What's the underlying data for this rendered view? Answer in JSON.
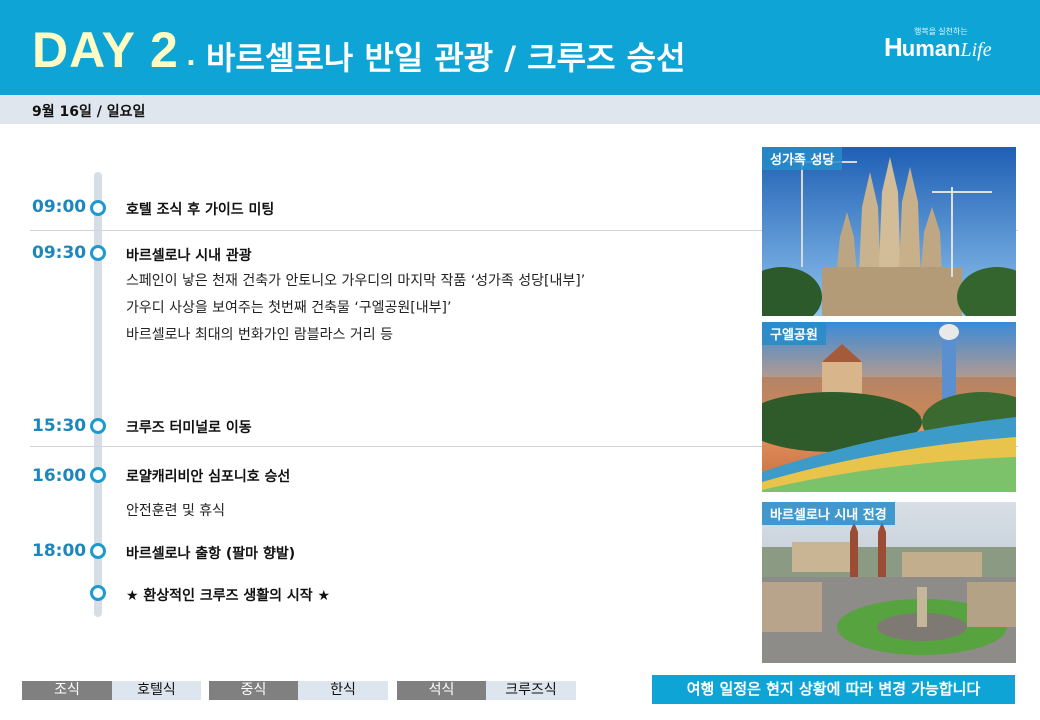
{
  "header": {
    "day": "DAY  2",
    "dot": ".",
    "title": "바르셀로나 반일 관광 / 크루즈 승선",
    "logo": {
      "h": "H",
      "uman": "uman",
      "life": "Life",
      "tag": "행복을 실천하는"
    }
  },
  "date": "9월 16일 / 일요일",
  "schedule": [
    {
      "time": "09:00",
      "lines": [
        "호텔 조식 후 가이드 미팅"
      ]
    },
    {
      "time": "09:30",
      "lines": [
        "바르셀로나 시내 관광",
        "스페인이 낳은 천재 건축가 안토니오 가우디의 마지막 작품 ‘성가족 성당[내부]’",
        "가우디 사상을 보여주는 첫번째 건축물 ‘구엘공원[내부]’",
        "바르셀로나 최대의 번화가인 람블라스 거리 등"
      ]
    },
    {
      "time": "15:30",
      "lines": [
        "크루즈 터미널로 이동"
      ]
    },
    {
      "time": "16:00",
      "lines": [
        "로얄캐리비안 심포니호 승선",
        "안전훈련 및 휴식"
      ]
    },
    {
      "time": "18:00",
      "lines": [
        "바르셀로나 출항 (팔마 향발)"
      ]
    },
    {
      "time": "",
      "lines": [
        "★ 환상적인 크루즈 생활의 시작 ★"
      ]
    }
  ],
  "photos": [
    {
      "label": "성가족 성당"
    },
    {
      "label": "구엘공원"
    },
    {
      "label": "바르셀로나 시내 전경"
    }
  ],
  "meals": [
    {
      "label": "조식",
      "value": "호텔식"
    },
    {
      "label": "중식",
      "value": "한식"
    },
    {
      "label": "석식",
      "value": "크루즈식"
    }
  ],
  "notice": "여행 일정은 현지 상황에 따라 변경 가능합니다",
  "colors": {
    "accent": "#0ea5d6",
    "time": "#1d86bd",
    "dayText": "#fffbc4"
  }
}
